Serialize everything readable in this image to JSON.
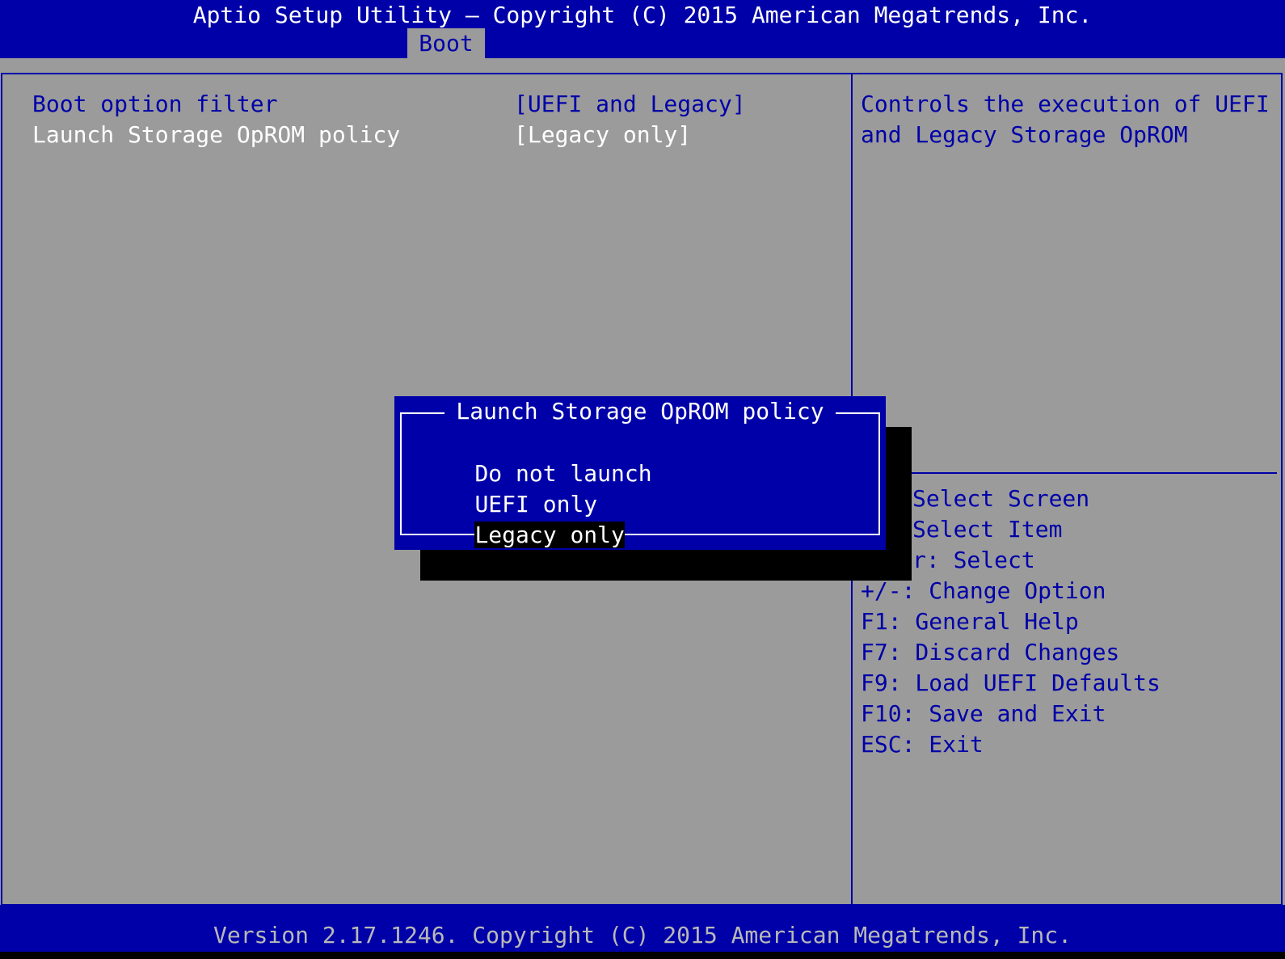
{
  "header": {
    "title": "Aptio Setup Utility – Copyright (C) 2015 American Megatrends, Inc.",
    "active_tab": "Boot"
  },
  "settings": [
    {
      "label": "Boot option filter",
      "value": "[UEFI and Legacy]"
    },
    {
      "label": "Launch Storage OpROM policy",
      "value": "[Legacy only]"
    }
  ],
  "help": {
    "line1": "Controls the execution of UEFI",
    "line2": "and Legacy Storage OpROM"
  },
  "keys": [
    "Select Screen",
    "Select Item",
    "r: Select",
    "+/-: Change Option",
    "F1: General Help",
    "F7: Discard Changes",
    "F9: Load UEFI Defaults",
    "F10: Save and Exit",
    "ESC: Exit"
  ],
  "popup": {
    "title": "Launch Storage OpROM policy",
    "options": [
      "Do not launch",
      "UEFI only",
      "Legacy only"
    ],
    "selected": "Legacy only"
  },
  "footer": {
    "text": "Version 2.17.1246. Copyright (C) 2015 American Megatrends, Inc."
  },
  "colors": {
    "bios_blue": "#0000a8",
    "panel_gray": "#9b9b9b",
    "text_white": "#ffffff"
  }
}
